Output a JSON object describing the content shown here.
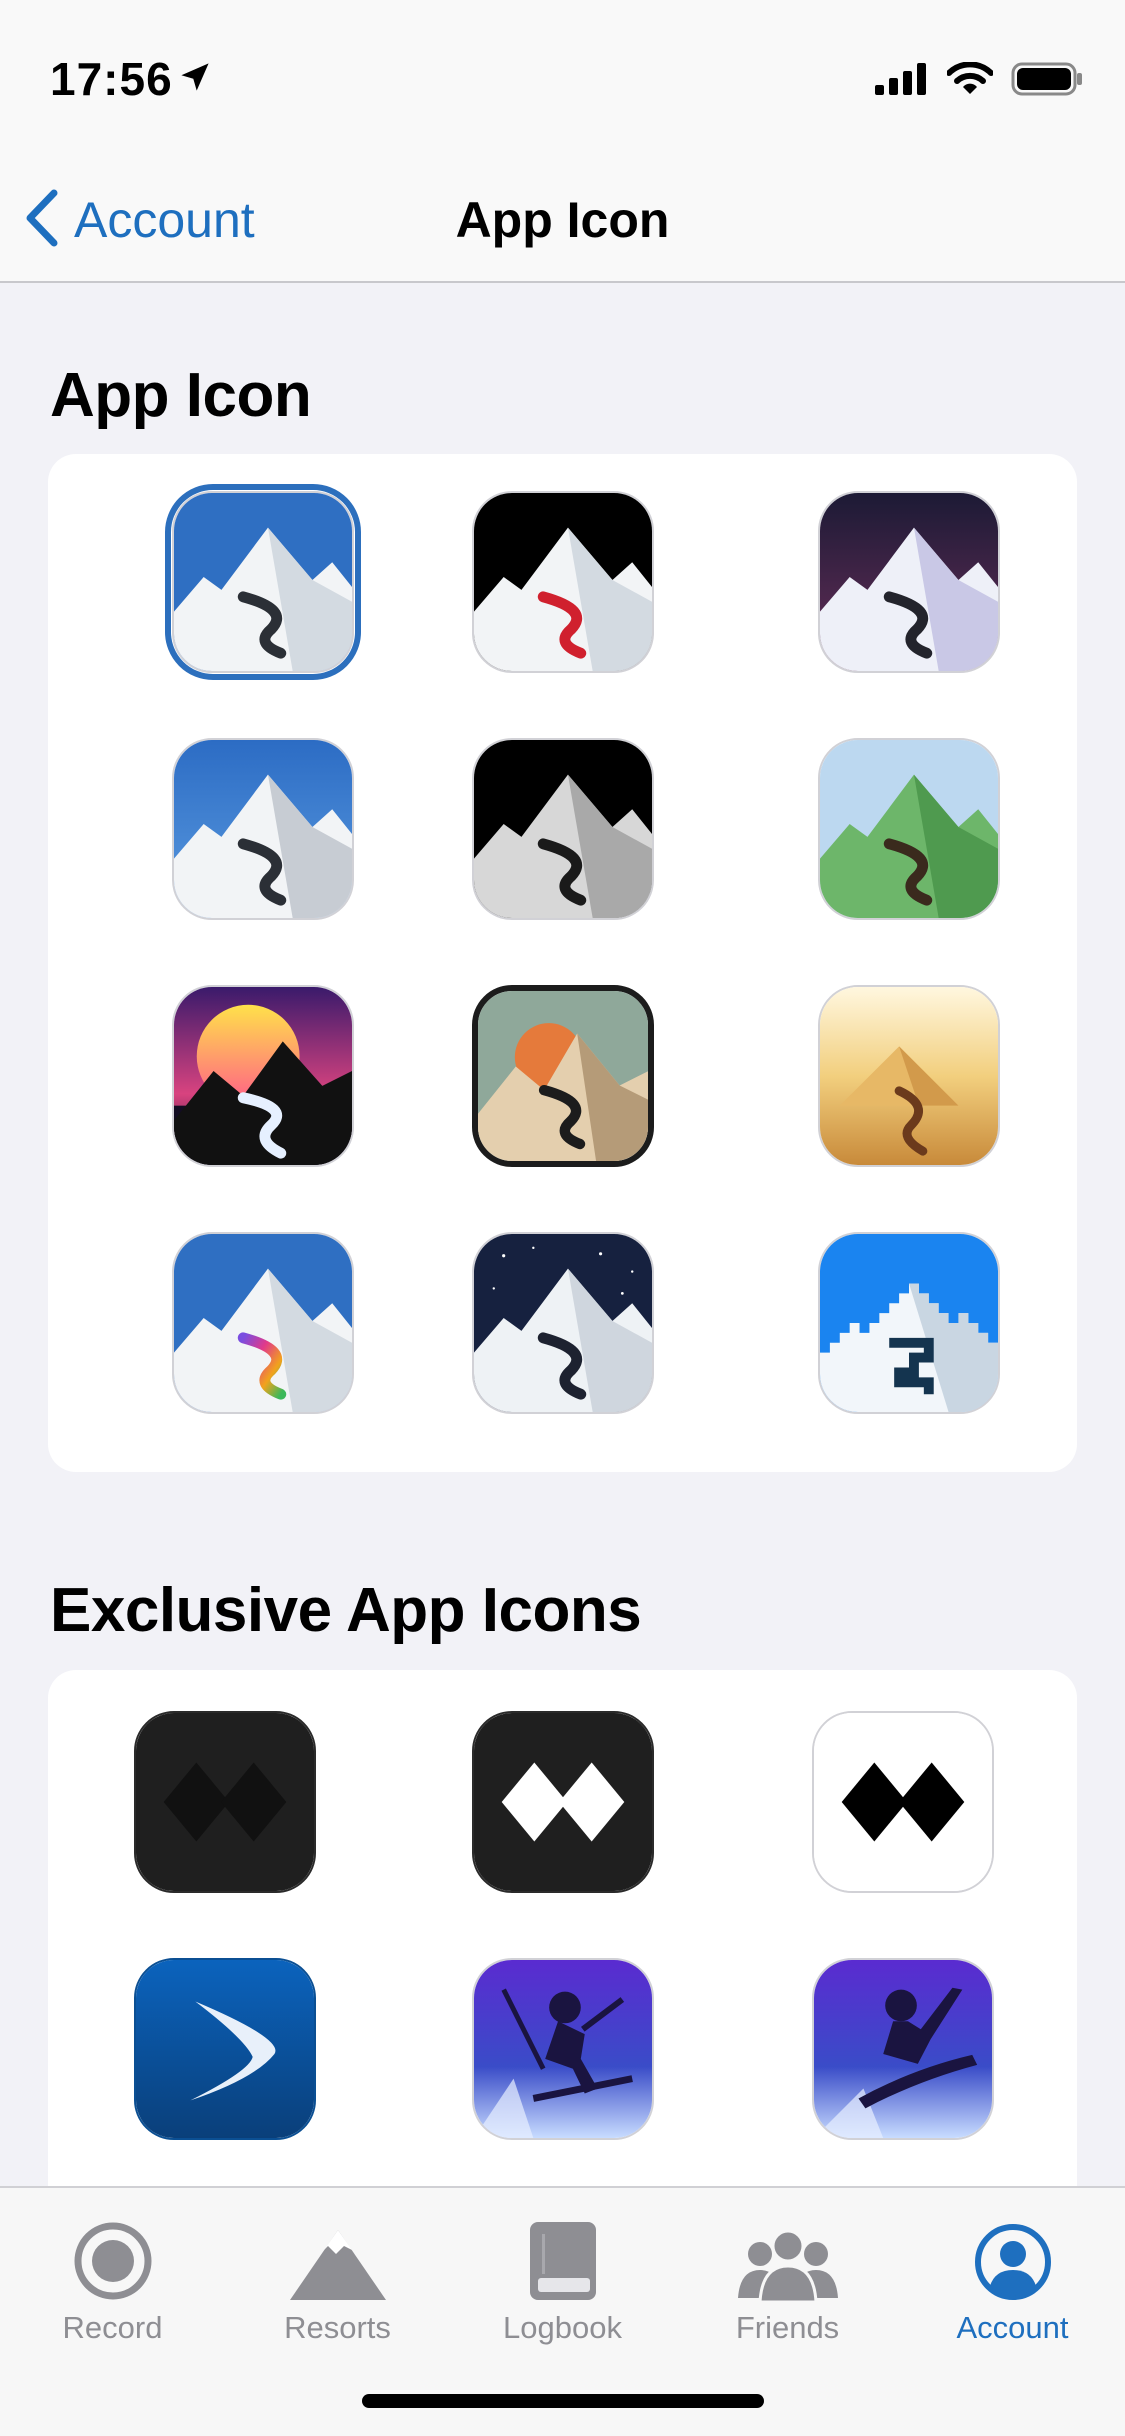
{
  "status": {
    "time": "17:56"
  },
  "nav": {
    "back_label": "Account",
    "title": "App Icon"
  },
  "sections": [
    {
      "title": "App Icon"
    },
    {
      "title": "Exclusive App Icons"
    }
  ],
  "app_icons": [
    {
      "name": "classic-blue",
      "selected": true
    },
    {
      "name": "black-sky-red-trail",
      "selected": false
    },
    {
      "name": "purple-night",
      "selected": false
    },
    {
      "name": "blue-gradient",
      "selected": false
    },
    {
      "name": "monochrome",
      "selected": false
    },
    {
      "name": "green-mountains",
      "selected": false
    },
    {
      "name": "retro-sunset",
      "selected": false
    },
    {
      "name": "vintage-badge",
      "selected": false
    },
    {
      "name": "desert",
      "selected": false
    },
    {
      "name": "rainbow-trail",
      "selected": false
    },
    {
      "name": "starry-night",
      "selected": false
    },
    {
      "name": "pixel-art",
      "selected": false
    }
  ],
  "exclusive_icons": [
    {
      "name": "double-diamond-dark"
    },
    {
      "name": "double-diamond-white-on-black"
    },
    {
      "name": "double-diamond-black-on-white"
    },
    {
      "name": "swoosh-blue"
    },
    {
      "name": "skier-purple"
    },
    {
      "name": "snowboarder-purple"
    }
  ],
  "tabs": [
    {
      "label": "Record",
      "icon": "record-icon",
      "active": false
    },
    {
      "label": "Resorts",
      "icon": "mountain-icon",
      "active": false
    },
    {
      "label": "Logbook",
      "icon": "book-icon",
      "active": false
    },
    {
      "label": "Friends",
      "icon": "friends-icon",
      "active": false
    },
    {
      "label": "Account",
      "icon": "account-icon",
      "active": true
    }
  ],
  "colors": {
    "accent": "#1e6fbf",
    "tab_inactive": "#8e8e93",
    "background": "#f2f2f7"
  }
}
